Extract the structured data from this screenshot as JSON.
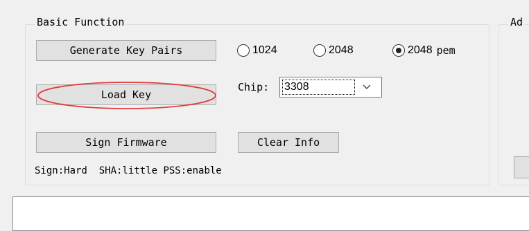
{
  "basic_function": {
    "title": "Basic Function",
    "buttons": {
      "generate": "Generate Key Pairs",
      "load": "Load Key",
      "sign": "Sign Firmware",
      "clear": "Clear Info"
    },
    "key_size": {
      "options": [
        "1024",
        "2048",
        "2048"
      ],
      "pem_suffix": "pem",
      "selected_index": 2
    },
    "chip": {
      "label": "Chip:",
      "value": "3308"
    },
    "status": {
      "sign": "Sign:Hard",
      "sha": "SHA:little",
      "pss": "PSS:enable"
    }
  },
  "advanced": {
    "title": "Ad"
  },
  "log": {
    "text": ""
  },
  "colors": {
    "highlight": "#e03c3c",
    "button_face": "#e1e1e1",
    "window_bg": "#f0f0f0"
  }
}
